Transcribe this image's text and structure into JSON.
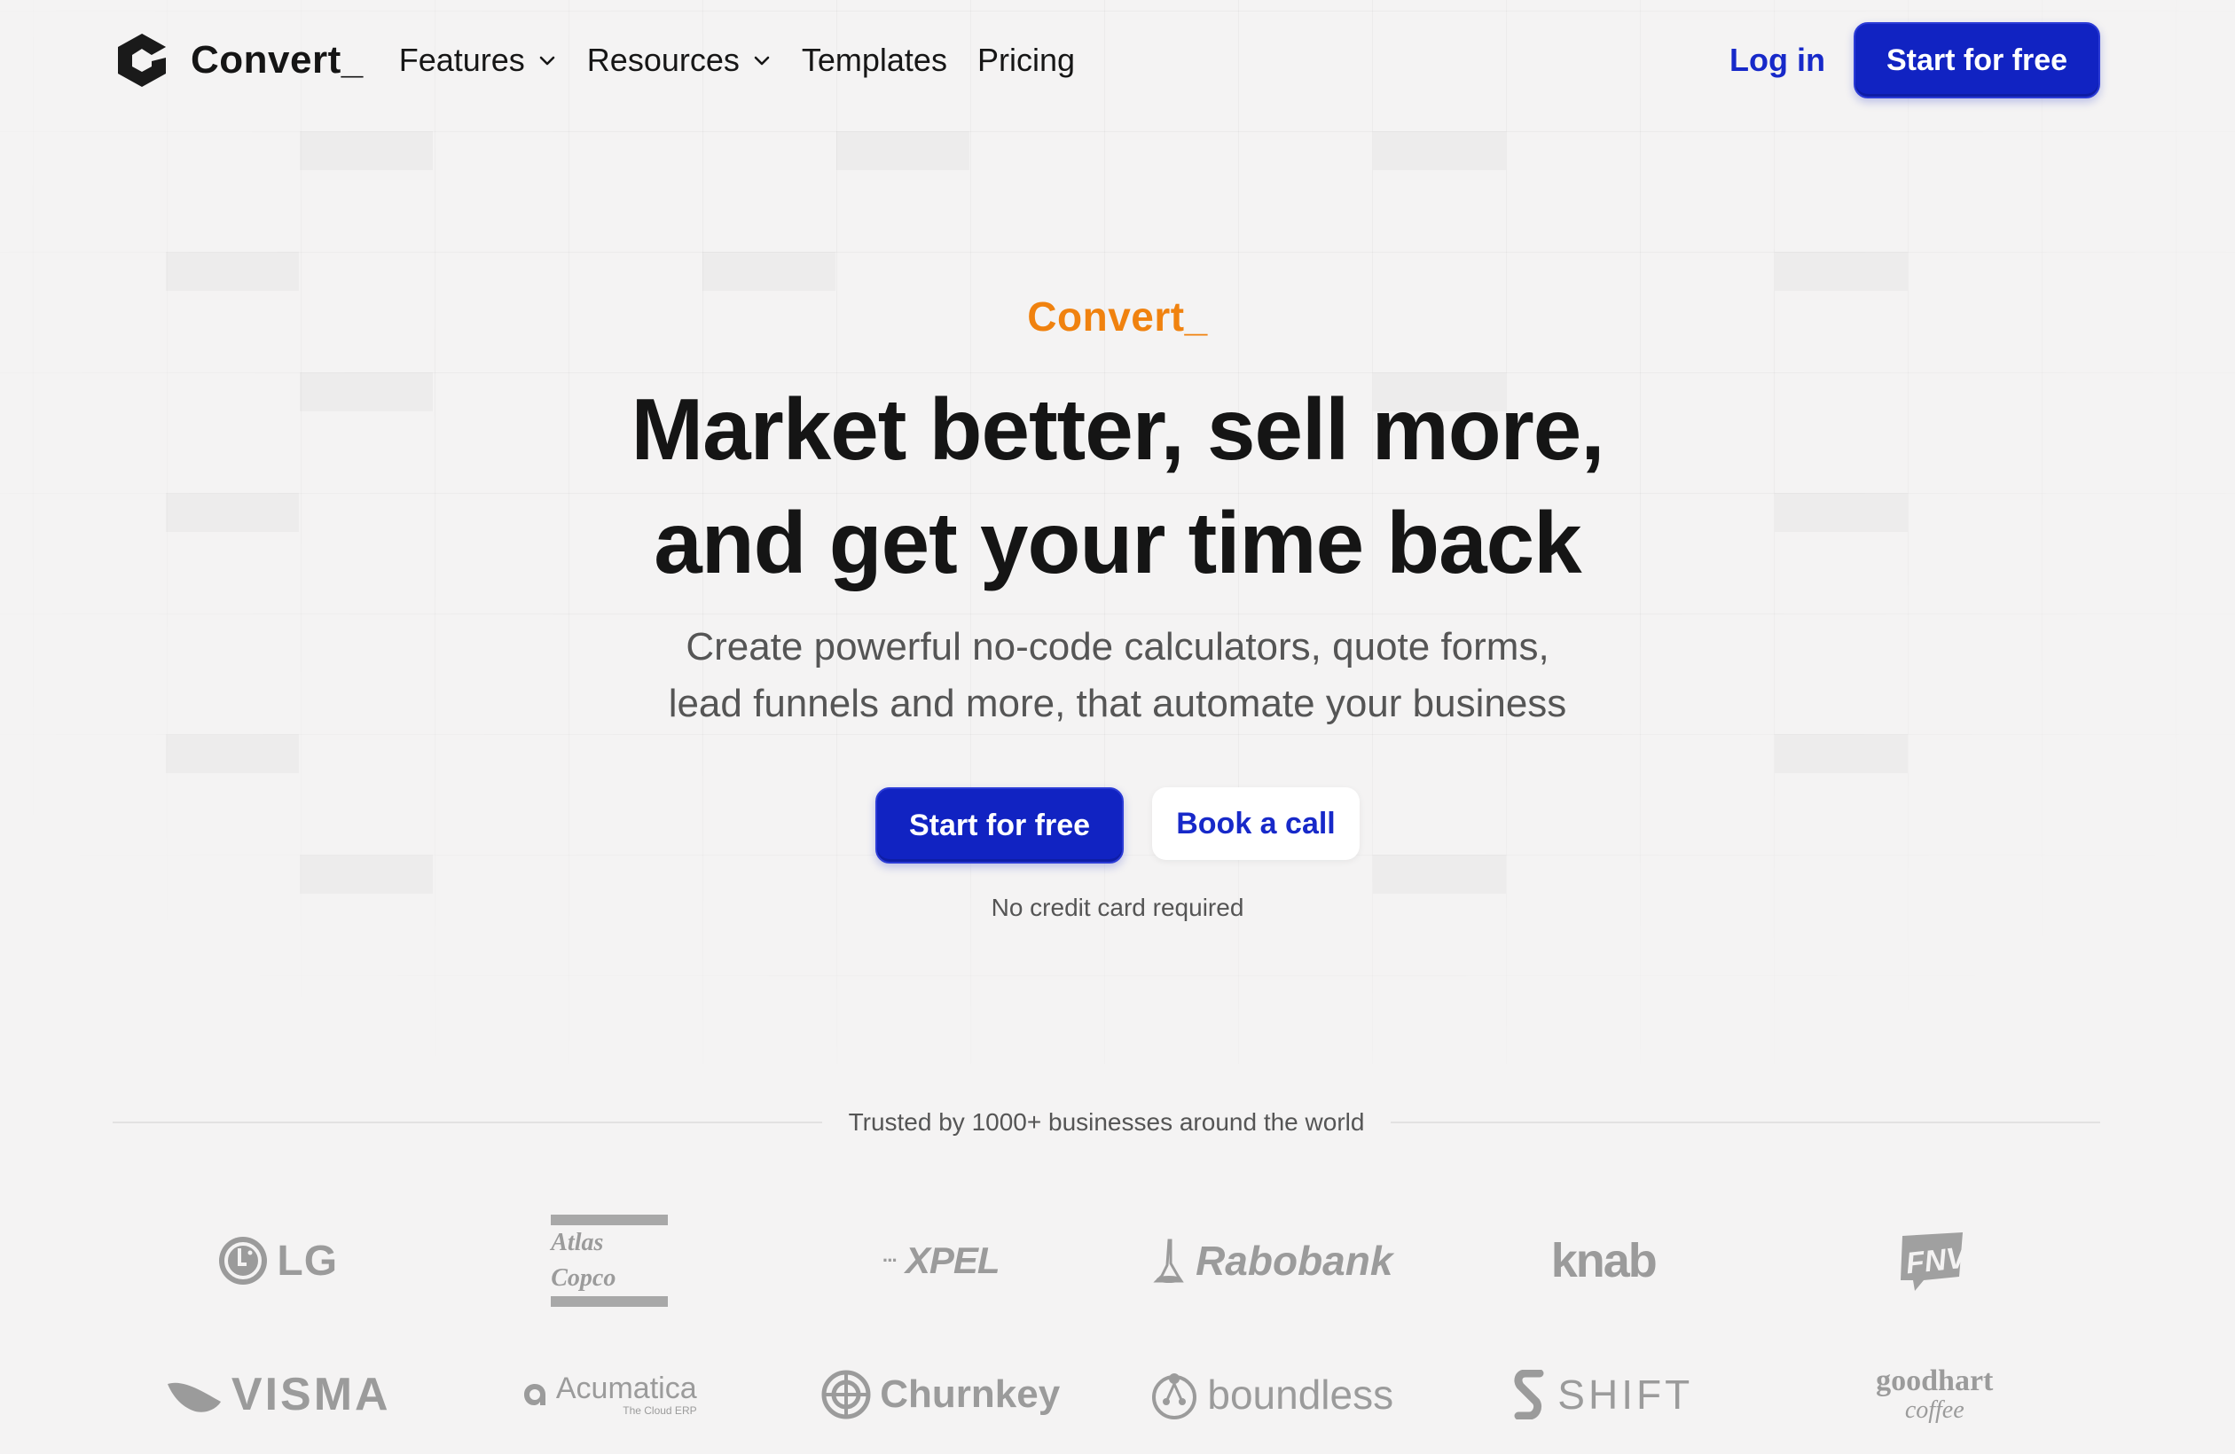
{
  "brand": {
    "name": "Convert_"
  },
  "nav": {
    "links": [
      {
        "label": "Features",
        "has_dropdown": true
      },
      {
        "label": "Resources",
        "has_dropdown": true
      },
      {
        "label": "Templates",
        "has_dropdown": false
      },
      {
        "label": "Pricing",
        "has_dropdown": false
      }
    ],
    "login_label": "Log in",
    "cta_label": "Start for free"
  },
  "hero": {
    "eyebrow": "Convert_",
    "headline_line1": "Market better, sell more,",
    "headline_line2": "and get your time back",
    "subhead_line1": "Create powerful no-code calculators, quote forms,",
    "subhead_line2": "lead funnels and more, that automate your business",
    "primary_cta": "Start for free",
    "secondary_cta": "Book a call",
    "note": "No credit card required"
  },
  "trusted": {
    "text": "Trusted by 1000+ businesses around the world",
    "logos_row1": [
      "LG",
      "Atlas Copco",
      "XPEL",
      "Rabobank",
      "knab",
      "FNV"
    ],
    "logos_row2": [
      "VISMA",
      "Acumatica",
      "Churnkey",
      "boundless",
      "SHIFT",
      "goodhart"
    ],
    "acumatica_tagline": "The Cloud ERP",
    "goodhart_sub": "coffee"
  },
  "colors": {
    "accent_blue": "#1123c2",
    "eyebrow_orange": "#f0820f",
    "background": "#f4f3f3",
    "logo_gray": "#9b9b9b"
  }
}
